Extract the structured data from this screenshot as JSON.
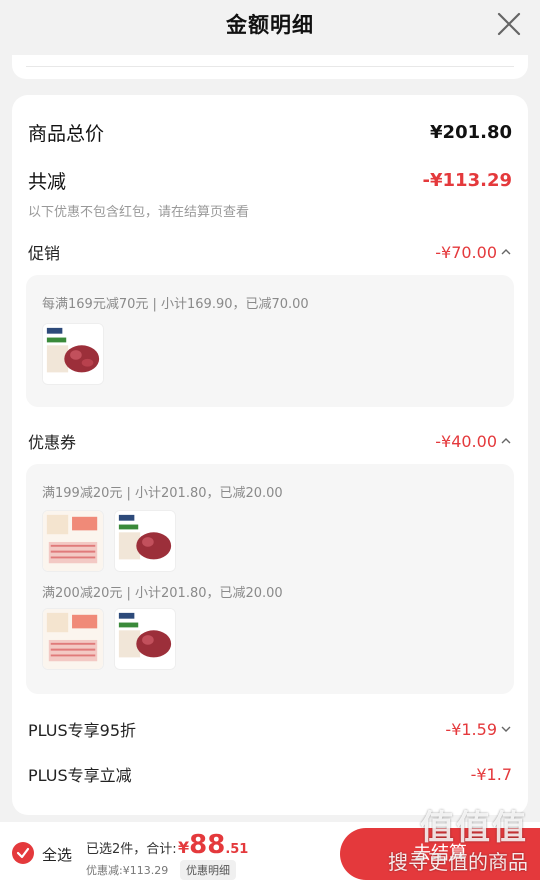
{
  "header": {
    "title": "金额明细"
  },
  "summary": {
    "total_label": "商品总价",
    "total_value": "¥201.80",
    "reduce_label": "共减",
    "reduce_value": "-¥113.29",
    "note": "以下优惠不包含红包，请在结算页查看"
  },
  "promo": {
    "label": "促销",
    "value": "-¥70.00",
    "detail": "每满169元减70元 | 小计169.90，已减70.00"
  },
  "coupon": {
    "label": "优惠券",
    "value": "-¥40.00",
    "detail1": "满199减20元 | 小计201.80，已减20.00",
    "detail2": "满200减20元 | 小计201.80，已减20.00"
  },
  "plus_discount": {
    "label": "PLUS专享95折",
    "value": "-¥1.59"
  },
  "plus_reduce": {
    "label": "PLUS专享立减",
    "value": "-¥1.7"
  },
  "bottom": {
    "select_all": "全选",
    "selected_count": "已选2件，合计:",
    "currency": "¥",
    "total_int": "88",
    "total_dec": ".51",
    "discount": "优惠减:¥113.29",
    "detail_btn": "优惠明细",
    "checkout": "去结算"
  },
  "watermark": {
    "big": "值值值",
    "small": "搜寻更值的商品"
  },
  "colors": {
    "accent": "#e4393c",
    "background": "#f2f2f2"
  },
  "icons": {
    "close": "close-icon",
    "chevron_up": "chevron-up-icon",
    "chevron_down": "chevron-down-icon",
    "check": "check-circle-icon"
  }
}
